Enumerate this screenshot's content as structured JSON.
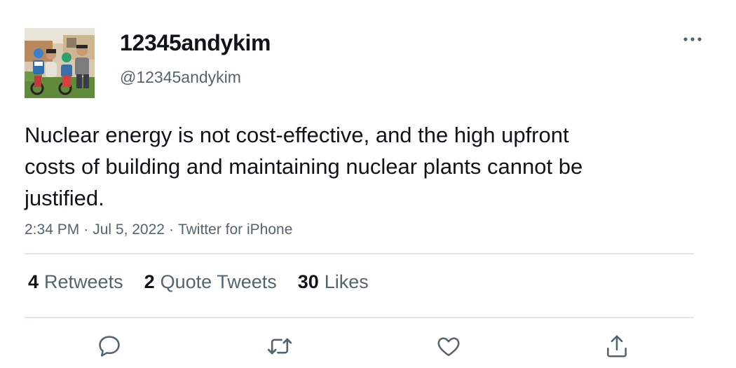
{
  "user": {
    "display_name": "12345andykim",
    "handle": "@12345andykim",
    "avatar": "family-photo-avatar"
  },
  "tweet": {
    "text": "Nuclear energy is not cost-effective, and the high upfront costs of building and maintaining nuclear plants cannot be justified.",
    "time": "2:34 PM",
    "date": "Jul 5, 2022",
    "source": "Twitter for iPhone",
    "separator": "·"
  },
  "stats": {
    "retweets_count": "4",
    "retweets_label": "Retweets",
    "quotes_count": "2",
    "quotes_label": "Quote Tweets",
    "likes_count": "30",
    "likes_label": "Likes"
  },
  "actions": {
    "reply_icon": "reply-icon",
    "retweet_icon": "retweet-icon",
    "like_icon": "heart-icon",
    "share_icon": "share-icon",
    "more_icon": "more-icon"
  },
  "colors": {
    "text_primary": "#0f1419",
    "text_secondary": "#536471",
    "divider": "#e1e6ea"
  }
}
